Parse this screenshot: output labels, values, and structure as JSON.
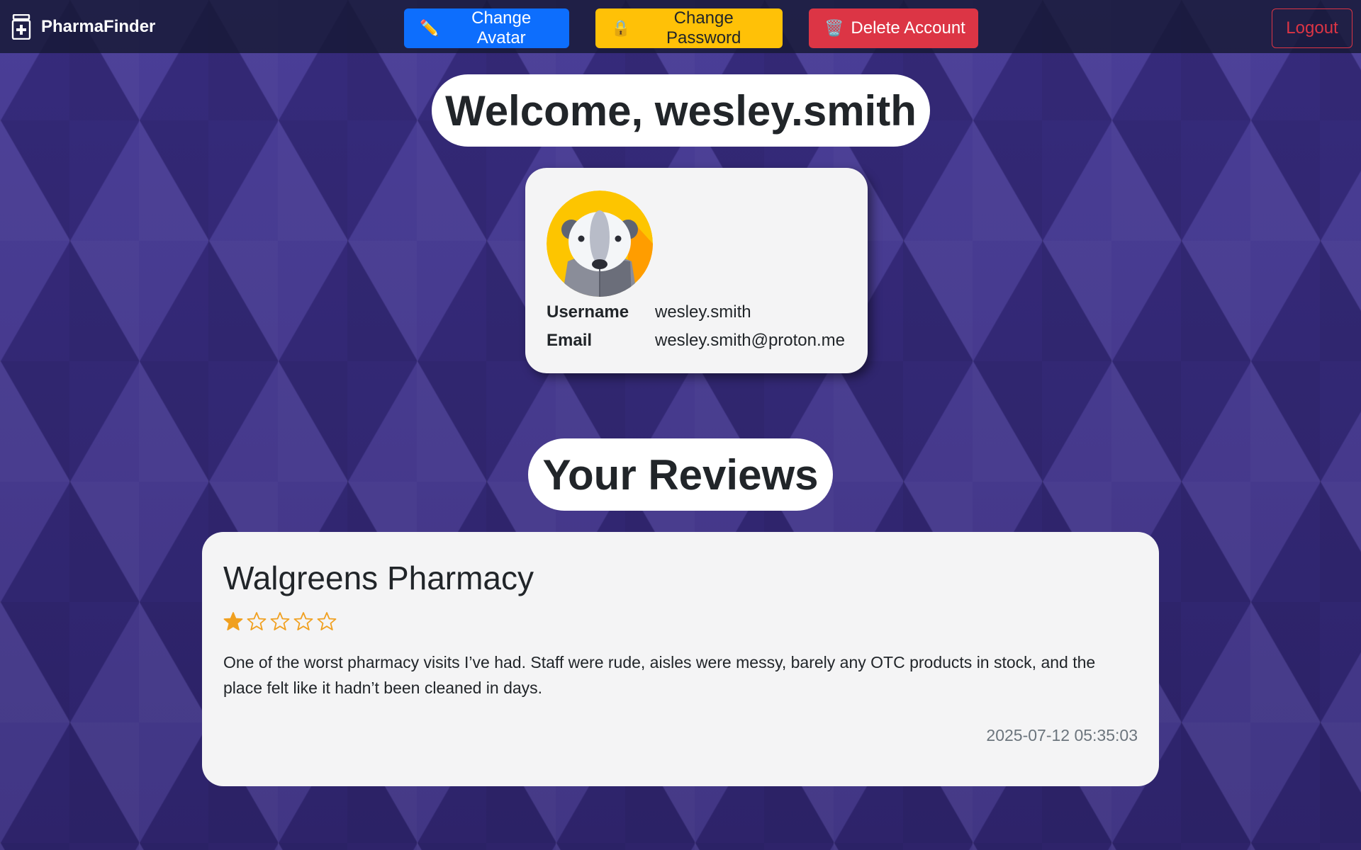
{
  "brand": {
    "name": "PharmaFinder",
    "icon": "medicine-bottle-icon"
  },
  "nav": {
    "change_avatar": "Change Avatar",
    "change_password": "Change Password",
    "delete_account": "Delete Account",
    "logout": "Logout",
    "icons": {
      "change_avatar": "pencil-icon",
      "change_password": "lock-icon",
      "delete_account": "trash-icon"
    }
  },
  "welcome": "Welcome, wesley.smith",
  "profile": {
    "avatar": "badger-avatar",
    "username_label": "Username",
    "username": "wesley.smith",
    "email_label": "Email",
    "email": "wesley.smith@proton.me"
  },
  "reviews_title": "Your Reviews",
  "reviews": [
    {
      "pharmacy": "Walgreens Pharmacy",
      "rating": 1,
      "max_rating": 5,
      "text": "One of the worst pharmacy visits I’ve had. Staff were rude, aisles were messy, barely any OTC products in stock, and the place felt like it hadn’t been cleaned in days.",
      "date": "2025-07-12 05:35:03"
    }
  ],
  "colors": {
    "primary": "#0d6efd",
    "warning": "#ffc107",
    "danger": "#dc3545",
    "star": "#f0a020",
    "background": "#3b2f86"
  }
}
